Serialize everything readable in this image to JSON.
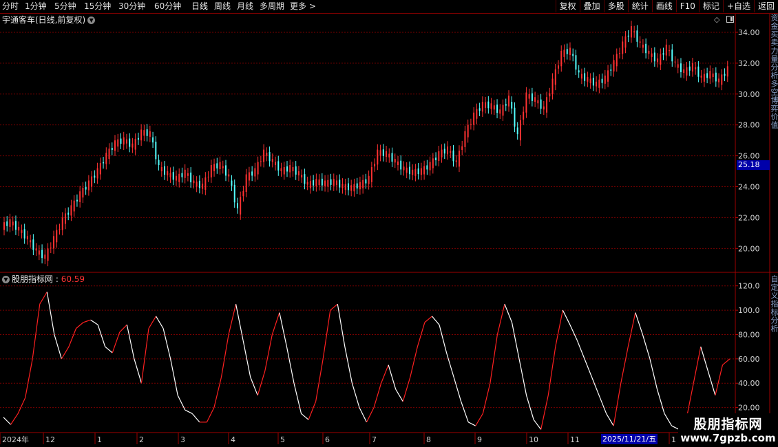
{
  "toolbar": {
    "periods": [
      {
        "label": "分时",
        "active": false
      },
      {
        "label": "1分钟",
        "active": false
      },
      {
        "label": "5分钟",
        "active": false
      },
      {
        "label": "15分钟",
        "active": false
      },
      {
        "label": "30分钟",
        "active": false
      },
      {
        "label": "60分钟",
        "active": false
      },
      {
        "label": "日线",
        "active": true
      },
      {
        "label": "周线",
        "active": false
      },
      {
        "label": "月线",
        "active": false
      },
      {
        "label": "多周期",
        "active": false
      },
      {
        "label": "更多 >",
        "active": false
      }
    ],
    "buttons": [
      "复权",
      "叠加",
      "多股",
      "统计",
      "画线",
      "F10",
      "标记",
      "+自选",
      "返回"
    ]
  },
  "chart": {
    "title": "宇通客车(日线,前复权)",
    "price_axis": [
      "34.00",
      "32.00",
      "30.00",
      "28.00",
      "26.00",
      "24.00",
      "22.00",
      "20.00"
    ],
    "current_price": "25.18",
    "indicator_name": "股朋指标网",
    "indicator_value": "60.59",
    "indicator_axis": [
      "120.0",
      "100.0",
      "80.00",
      "60.00",
      "40.00",
      "20.00"
    ],
    "date_labels": [
      "2024年",
      "12",
      "1",
      "2",
      "3",
      "4",
      "5",
      "6",
      "7",
      "8",
      "9",
      "10",
      "11",
      "1"
    ],
    "cursor_date": "2025/11/21/五",
    "side_labels_top": "资金买卖力量分析多空博弈价值",
    "side_labels_bottom": "自定义指标分析",
    "colors": {
      "up": "#ff3232",
      "down": "#54ffff",
      "grid": "#7a0000",
      "indicator_up": "#ff2020",
      "indicator_down": "#ffffff",
      "price_tag": "#0000aa"
    }
  },
  "chart_data": [
    {
      "type": "candlestick",
      "title": "宇通客车(日线,前复权)",
      "ylim": [
        18.5,
        35.2
      ],
      "x_labels": [
        "2024年",
        "12",
        "1",
        "2",
        "3",
        "4",
        "5",
        "6",
        "7",
        "8",
        "9",
        "10",
        "11",
        "1"
      ],
      "close": [
        21.7,
        21.2,
        20.6,
        19.8,
        19.4,
        20.6,
        21.8,
        22.6,
        23.5,
        24.2,
        25.0,
        26.0,
        26.8,
        27.0,
        26.6,
        27.5,
        27.4,
        25.2,
        24.8,
        24.5,
        24.9,
        24.2,
        24.0,
        25.2,
        25.4,
        24.6,
        22.4,
        24.6,
        25.0,
        26.2,
        25.6,
        25.0,
        25.2,
        24.8,
        24.1,
        24.3,
        24.2,
        24.3,
        24.0,
        23.9,
        24.1,
        24.5,
        26.2,
        26.1,
        25.6,
        25.1,
        24.9,
        25.0,
        25.4,
        26.1,
        26.4,
        25.5,
        27.4,
        28.6,
        29.3,
        29.2,
        28.8,
        29.7,
        27.2,
        29.9,
        29.6,
        29.0,
        30.8,
        32.6,
        32.8,
        31.2,
        30.9,
        30.6,
        31.0,
        32.0,
        33.2,
        34.2,
        33.2,
        32.6,
        32.1,
        33.0,
        31.9,
        31.4,
        31.8,
        31.0,
        31.3,
        30.8,
        31.6
      ],
      "current_price": 25.18
    },
    {
      "type": "line",
      "title": "股朋指标网",
      "ylim": [
        0,
        130
      ],
      "series": [
        {
          "name": "股朋指标网",
          "values": [
            12,
            6,
            15,
            28,
            60,
            105,
            115,
            80,
            60,
            70,
            85,
            90,
            92,
            88,
            70,
            65,
            82,
            88,
            60,
            40,
            85,
            95,
            85,
            60,
            30,
            18,
            15,
            8,
            8,
            20,
            45,
            80,
            105,
            75,
            45,
            30,
            50,
            80,
            98,
            70,
            40,
            15,
            10,
            25,
            60,
            100,
            105,
            70,
            40,
            20,
            8,
            20,
            40,
            55,
            35,
            25,
            45,
            70,
            90,
            95,
            88,
            65,
            45,
            25,
            8,
            5,
            15,
            40,
            80,
            105,
            90,
            60,
            30,
            10,
            2,
            30,
            70,
            100,
            88,
            75,
            60,
            45,
            30,
            15,
            5,
            40,
            70,
            98,
            80,
            60,
            35,
            15,
            5,
            2,
            10,
            40,
            70,
            50,
            30,
            55,
            60
          ]
        }
      ],
      "last_value": 60.59
    }
  ],
  "watermark": {
    "line1": "股朋指标网",
    "line2": "www.7gpzb.com"
  }
}
